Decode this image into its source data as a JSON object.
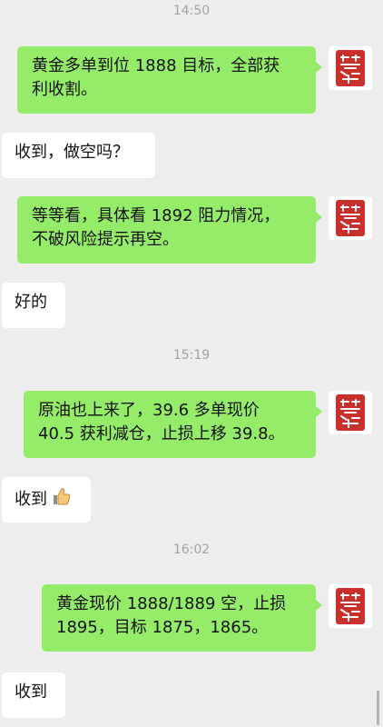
{
  "timestamps": [
    "14:50",
    "15:19",
    "16:02"
  ],
  "messages": [
    {
      "side": "out",
      "text": "黄金多单到位1888目标，全部获利收割。"
    },
    {
      "side": "in",
      "text": "收到，做空吗？"
    },
    {
      "side": "out",
      "text": "等等看，具体看1892阻力情况，不破风险提示再空。"
    },
    {
      "side": "in",
      "text": "好的"
    },
    {
      "side": "out",
      "text": "原油也上来了，39.6多单现价40.5获利减仓，止损上移39.8。"
    },
    {
      "side": "in",
      "text": "收到",
      "emoji": "thumbs-up-icon"
    },
    {
      "side": "out",
      "text": "黄金现价1888/1889空，止损1895，目标1875，1865。"
    },
    {
      "side": "in",
      "text": "收到"
    }
  ],
  "display_lines": {
    "m0": [
      "黄金多单到位 1888 目标，全部获",
      "利收割。"
    ],
    "m2": [
      "等等看，具体看 1892 阻力情况，",
      "不破风险提示再空。"
    ],
    "m4": [
      "原油也上来了，39.6 多单现价",
      "40.5 获利减仓，止损上移 39.8。"
    ],
    "m6": [
      "黄金现价 1888/1889 空，止损",
      "1895，目标 1875，1865。"
    ]
  },
  "avatar": {
    "icon": "red-seal-stamp-avatar",
    "color": "#c8302c"
  },
  "colors": {
    "outgoing_bubble": "#95ec69",
    "incoming_bubble": "#ffffff",
    "background": "#ededed",
    "timestamp": "#a3a3a3"
  }
}
